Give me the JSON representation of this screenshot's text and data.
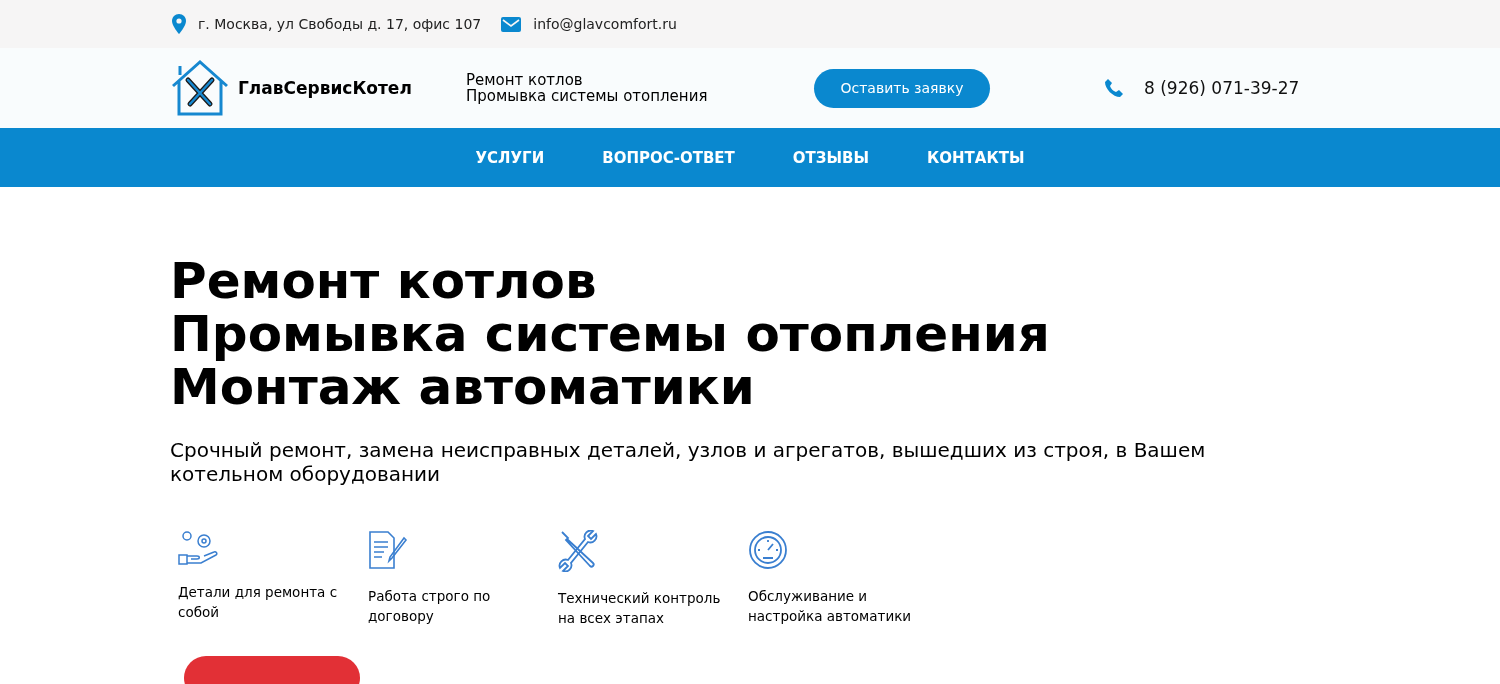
{
  "topbar": {
    "address": "г. Москва, ул Свободы д. 17, офис 107",
    "email": "info@glavcomfort.ru"
  },
  "header": {
    "brand": "ГлавСервисКотел",
    "tagline": [
      "Ремонт котлов",
      "Промывка системы отопления"
    ],
    "cta": "Оставить заявку",
    "phone": "8 (926) 071-39-27"
  },
  "nav": [
    "УСЛУГИ",
    "ВОПРОС-ОТВЕТ",
    "ОТЗЫВЫ",
    "КОНТАКТЫ"
  ],
  "hero": {
    "title": [
      "Ремонт котлов",
      "Промывка системы отопления",
      "Монтаж автоматики"
    ],
    "subtitle": "Срочный ремонт, замена неисправных деталей, узлов и агрегатов, вышедших из строя, в Вашем котельном оборудовании"
  },
  "features": [
    {
      "kind": "parts",
      "text": "Детали для ремонта с собой"
    },
    {
      "kind": "contract",
      "text": "Работа строго по договору"
    },
    {
      "kind": "tools",
      "text": "Технический контроль на всех этапах"
    },
    {
      "kind": "gauge",
      "text": "Обслуживание и настройка автоматики"
    }
  ]
}
